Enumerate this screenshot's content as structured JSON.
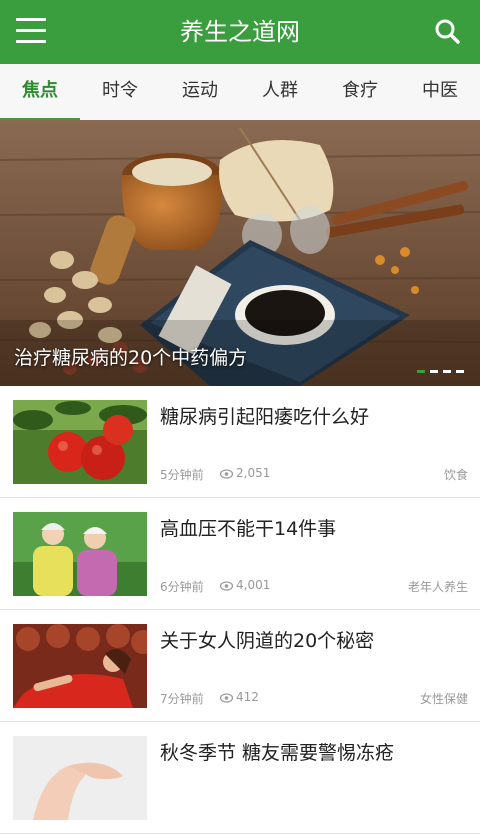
{
  "app": {
    "title": "养生之道网",
    "accent": "#3a9d3e"
  },
  "tabs": [
    {
      "label": "焦点",
      "active": true
    },
    {
      "label": "时令",
      "active": false
    },
    {
      "label": "运动",
      "active": false
    },
    {
      "label": "人群",
      "active": false
    },
    {
      "label": "食疗",
      "active": false
    },
    {
      "label": "中医",
      "active": false
    }
  ],
  "banner": {
    "caption": "治疗糖尿病的20个中药偏方",
    "slide_count": 4,
    "active_slide": 1
  },
  "articles": [
    {
      "title": "糖尿病引起阳痿吃什么好",
      "time": "5分钟前",
      "views": "2,051",
      "tag": "饮食",
      "thumb": "tomatoes-photo"
    },
    {
      "title": "高血压不能干14件事",
      "time": "6分钟前",
      "views": "4,001",
      "tag": "老年人养生",
      "thumb": "elderly-couple-photo"
    },
    {
      "title": "关于女人阴道的20个秘密",
      "time": "7分钟前",
      "views": "412",
      "tag": "女性保健",
      "thumb": "woman-red-dress-photo"
    },
    {
      "title": "秋冬季节 糖友需要警惕冻疮",
      "time": "",
      "views": "",
      "tag": "",
      "thumb": "hands-photo"
    }
  ]
}
